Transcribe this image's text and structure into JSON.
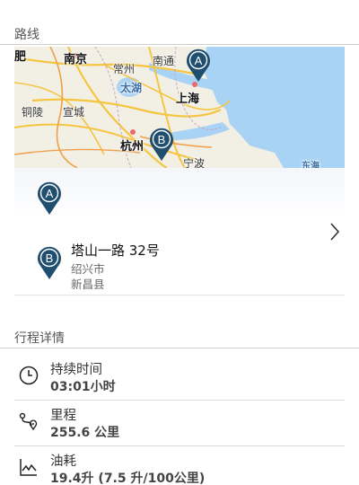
{
  "route_section": {
    "title": "路线"
  },
  "map": {
    "labels": {
      "nanjing": "南京",
      "changzhou": "常州",
      "nantong": "南通",
      "taihu": "太湖",
      "tongling": "铜陵",
      "xuancheng": "宣城",
      "shanghai": "上海",
      "hangzhou": "杭州",
      "ningbo": "宁波",
      "fei": "肥",
      "donghai": "东海"
    },
    "pin_a_label": "A",
    "pin_b_label": "B",
    "pin_color": "#1f4e6e"
  },
  "route": {
    "start_marker": "A",
    "end_marker": "B",
    "destination": {
      "title": "塔山一路 32号",
      "city": "绍兴市",
      "district": "新昌县"
    }
  },
  "trip_section": {
    "title": "行程详情"
  },
  "trip_details": [
    {
      "icon": "clock-icon",
      "label": "持续时间",
      "value": "03:01小时"
    },
    {
      "icon": "route-icon",
      "label": "里程",
      "value": "255.6 公里"
    },
    {
      "icon": "fuel-chart-icon",
      "label": "油耗",
      "value": "19.4升 (7.5 升/100公里)"
    }
  ]
}
